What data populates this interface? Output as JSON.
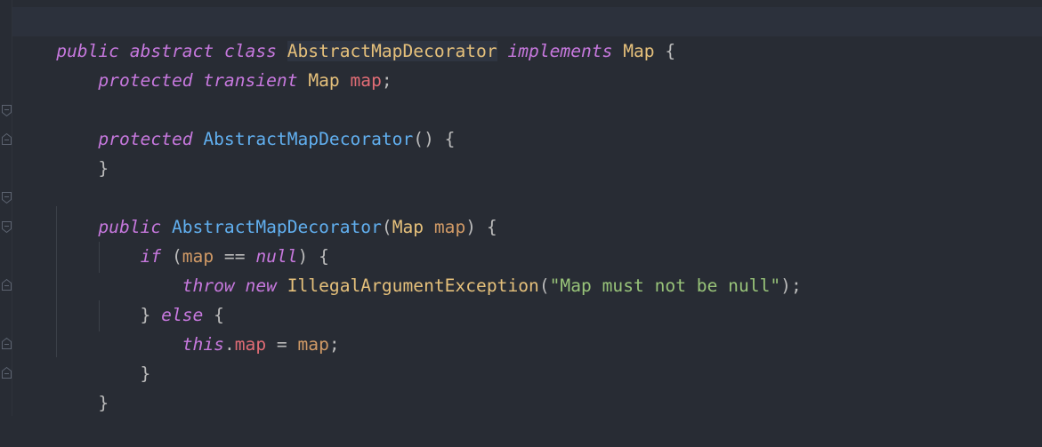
{
  "editor": {
    "colors": {
      "background": "#282c34",
      "keyword": "#c678dd",
      "type": "#e5c07b",
      "function": "#61afef",
      "field": "#e06c75",
      "parameter": "#d19a66",
      "string": "#98c379",
      "plain": "#bbbbbb"
    },
    "lines": [
      [
        "public",
        " ",
        "abstract",
        " ",
        "class",
        " ",
        "AbstractMapDecorator",
        " ",
        "implements",
        " ",
        "Map",
        " {"
      ],
      [
        "    ",
        "protected",
        " ",
        "transient",
        " ",
        "Map",
        " ",
        "map",
        ";"
      ],
      [
        ""
      ],
      [
        "    ",
        "protected",
        " ",
        "AbstractMapDecorator",
        "() {"
      ],
      [
        "    }"
      ],
      [
        ""
      ],
      [
        "    ",
        "public",
        " ",
        "AbstractMapDecorator",
        "(",
        "Map",
        " ",
        "map",
        ") {"
      ],
      [
        "        ",
        "if",
        " (",
        "map",
        " == ",
        "null",
        ") {"
      ],
      [
        "            ",
        "throw",
        " ",
        "new",
        " ",
        "IllegalArgumentException",
        "(",
        "\"Map must not be null\"",
        ");"
      ],
      [
        "        } ",
        "else",
        " {"
      ],
      [
        "            ",
        "this",
        ".",
        "map",
        " = ",
        "map",
        ";"
      ],
      [
        "        }"
      ],
      [
        "    }"
      ]
    ],
    "fold_icons": [
      "fold-open-icon",
      "fold-close-icon"
    ]
  }
}
